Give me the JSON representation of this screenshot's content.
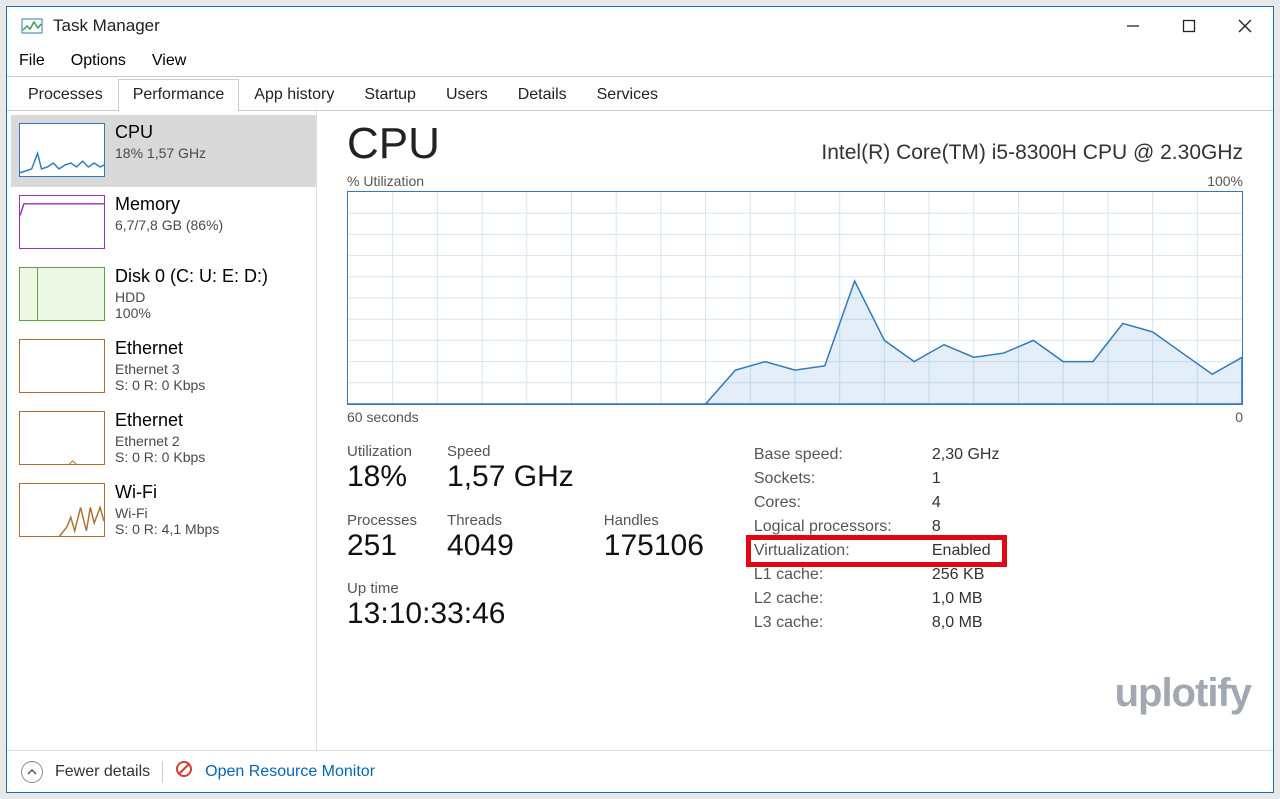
{
  "window": {
    "title": "Task Manager"
  },
  "menu": {
    "file": "File",
    "options": "Options",
    "view": "View"
  },
  "tabs": {
    "processes": "Processes",
    "performance": "Performance",
    "app_history": "App history",
    "startup": "Startup",
    "users": "Users",
    "details": "Details",
    "services": "Services"
  },
  "sidebar": {
    "cpu": {
      "label": "CPU",
      "sub1": "18%  1,57 GHz"
    },
    "memory": {
      "label": "Memory",
      "sub1": "6,7/7,8 GB (86%)"
    },
    "disk": {
      "label": "Disk 0 (C: U: E: D:)",
      "sub1": "HDD",
      "sub2": "100%"
    },
    "eth1": {
      "label": "Ethernet",
      "sub1": "Ethernet 3",
      "sub2": "S: 0 R: 0 Kbps"
    },
    "eth2": {
      "label": "Ethernet",
      "sub1": "Ethernet 2",
      "sub2": "S: 0 R: 0 Kbps"
    },
    "wifi": {
      "label": "Wi-Fi",
      "sub1": "Wi-Fi",
      "sub2": "S: 0 R: 4,1 Mbps"
    }
  },
  "main": {
    "title": "CPU",
    "cpu_name": "Intel(R) Core(TM) i5-8300H CPU @ 2.30GHz",
    "y_label": "% Utilization",
    "y_max": "100%",
    "x_label_left": "60 seconds",
    "x_label_right": "0",
    "stats": {
      "utilization_lbl": "Utilization",
      "utilization_val": "18%",
      "speed_lbl": "Speed",
      "speed_val": "1,57 GHz",
      "processes_lbl": "Processes",
      "processes_val": "251",
      "threads_lbl": "Threads",
      "threads_val": "4049",
      "handles_lbl": "Handles",
      "handles_val": "175106",
      "uptime_lbl": "Up time",
      "uptime_val": "13:10:33:46"
    },
    "details": {
      "base_speed_k": "Base speed:",
      "base_speed_v": "2,30 GHz",
      "sockets_k": "Sockets:",
      "sockets_v": "1",
      "cores_k": "Cores:",
      "cores_v": "4",
      "logical_k": "Logical processors:",
      "logical_v": "8",
      "virt_k": "Virtualization:",
      "virt_v": "Enabled",
      "l1_k": "L1 cache:",
      "l1_v": "256 KB",
      "l2_k": "L2 cache:",
      "l2_v": "1,0 MB",
      "l3_k": "L3 cache:",
      "l3_v": "8,0 MB"
    }
  },
  "footer": {
    "fewer": "Fewer details",
    "open_rm": "Open Resource Monitor"
  },
  "chart_data": {
    "type": "line",
    "title": "CPU % Utilization",
    "xlabel": "seconds ago",
    "ylabel": "% Utilization",
    "ylim": [
      0,
      100
    ],
    "x": [
      60,
      58,
      56,
      54,
      52,
      50,
      48,
      46,
      44,
      42,
      40,
      38,
      36,
      34,
      32,
      30,
      28,
      26,
      24,
      22,
      20,
      18,
      16,
      14,
      12,
      10,
      8,
      6,
      4,
      2,
      0
    ],
    "values": [
      0,
      0,
      0,
      0,
      0,
      0,
      0,
      0,
      0,
      0,
      0,
      0,
      0,
      16,
      20,
      16,
      18,
      58,
      30,
      20,
      28,
      22,
      24,
      30,
      20,
      20,
      38,
      34,
      24,
      14,
      22,
      26
    ]
  },
  "watermark": "uplotify"
}
